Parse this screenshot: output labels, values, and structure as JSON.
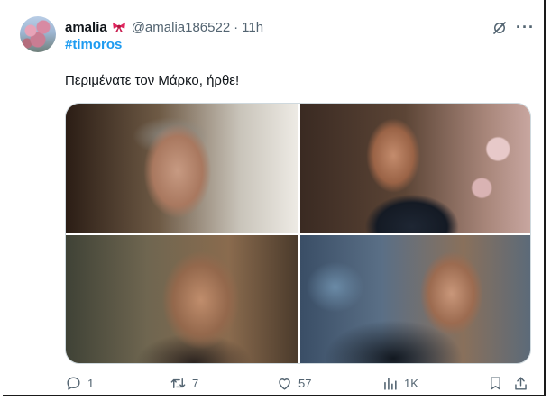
{
  "tweet": {
    "author_name": "amalia",
    "handle": "@amalia186522",
    "separator": "·",
    "time": "11h",
    "hashtag": "#timoros",
    "text": "Περιμένατε τον Μάρκο, ήρθε!",
    "more_label": "···"
  },
  "media": [
    {
      "name": "photo-1"
    },
    {
      "name": "photo-2"
    },
    {
      "name": "photo-3"
    },
    {
      "name": "photo-4"
    }
  ],
  "actions": {
    "reply_count": "1",
    "retweet_count": "7",
    "like_count": "57",
    "view_count": "1K"
  },
  "icons": [
    "avatar",
    "bow-icon",
    "grok-icon",
    "more-icon",
    "reply-icon",
    "retweet-icon",
    "like-icon",
    "views-icon",
    "bookmark-icon",
    "share-icon"
  ],
  "colors": {
    "link": "#1d9bf0",
    "text": "#0f1419",
    "muted": "#536471",
    "bow": "#e0245e"
  }
}
